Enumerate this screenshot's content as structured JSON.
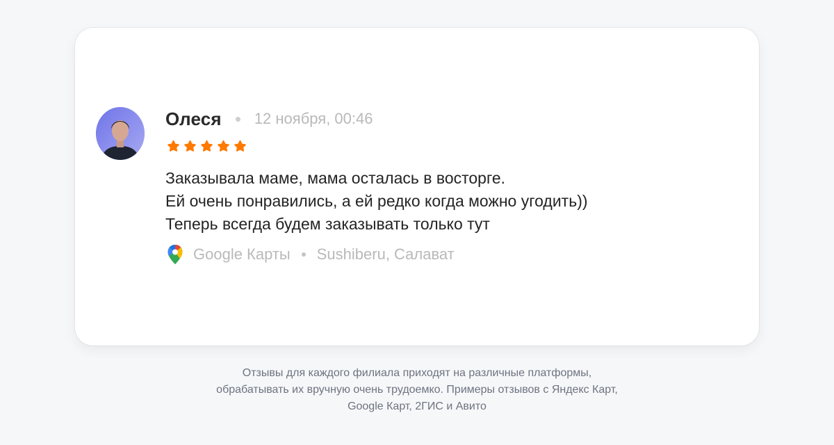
{
  "review": {
    "author": "Олеся",
    "date": "12 ноября, 00:46",
    "rating": 5,
    "rating_max": 5,
    "text_lines": [
      "Заказывала маме, мама осталась в восторге.",
      "Ей очень понравились, а ей редко когда можно угодить))",
      "Теперь всегда будем заказывать только тут"
    ],
    "source": "Google Карты",
    "branch": "Sushiberu, Салават",
    "source_icon": "google-maps-pin-icon"
  },
  "caption": {
    "lines": [
      "Отзывы для каждого филиала приходят на различные платформы,",
      "обрабатывать их вручную очень трудоемко. Примеры отзывов с Яндекс Карт,",
      "Google Карт, 2ГИС и Авито"
    ]
  },
  "colors": {
    "page_background": "#f6f7f9",
    "card_background": "#ffffff",
    "star": "#ff7a00",
    "author_text": "#2a2a2a",
    "muted_text": "#b9b9b9",
    "caption_text": "#6d7380"
  }
}
